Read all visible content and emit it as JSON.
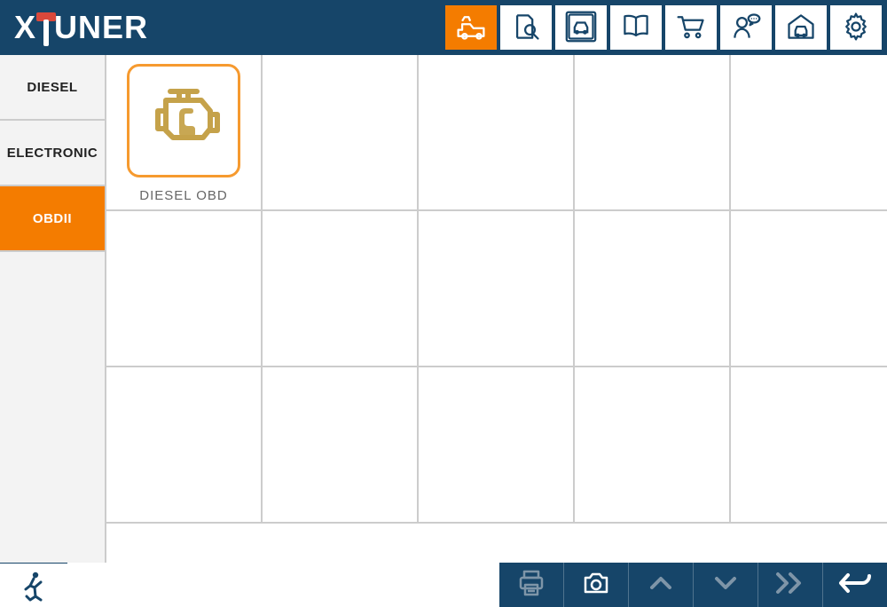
{
  "brand": {
    "name": "XTUNER"
  },
  "toolbar": {
    "items": [
      {
        "name": "truck",
        "active": true
      },
      {
        "name": "search",
        "active": false
      },
      {
        "name": "car-frame",
        "active": false
      },
      {
        "name": "manual",
        "active": false
      },
      {
        "name": "cart",
        "active": false
      },
      {
        "name": "support",
        "active": false
      },
      {
        "name": "garage",
        "active": false
      },
      {
        "name": "settings",
        "active": false
      }
    ]
  },
  "sidebar": {
    "items": [
      {
        "label": "DIESEL",
        "active": false
      },
      {
        "label": "ELECTRONIC",
        "active": false
      },
      {
        "label": "OBDII",
        "active": true
      }
    ]
  },
  "grid": {
    "rows": 3,
    "cols": 5,
    "apps": [
      {
        "slot": 0,
        "label": "DIESEL OBD",
        "icon": "diesel-engine"
      }
    ]
  },
  "bottombar": {
    "buttons": [
      {
        "name": "print",
        "enabled": false
      },
      {
        "name": "camera",
        "enabled": true
      },
      {
        "name": "up",
        "enabled": false
      },
      {
        "name": "down",
        "enabled": false
      },
      {
        "name": "forward",
        "enabled": false
      },
      {
        "name": "back",
        "enabled": true
      }
    ]
  }
}
